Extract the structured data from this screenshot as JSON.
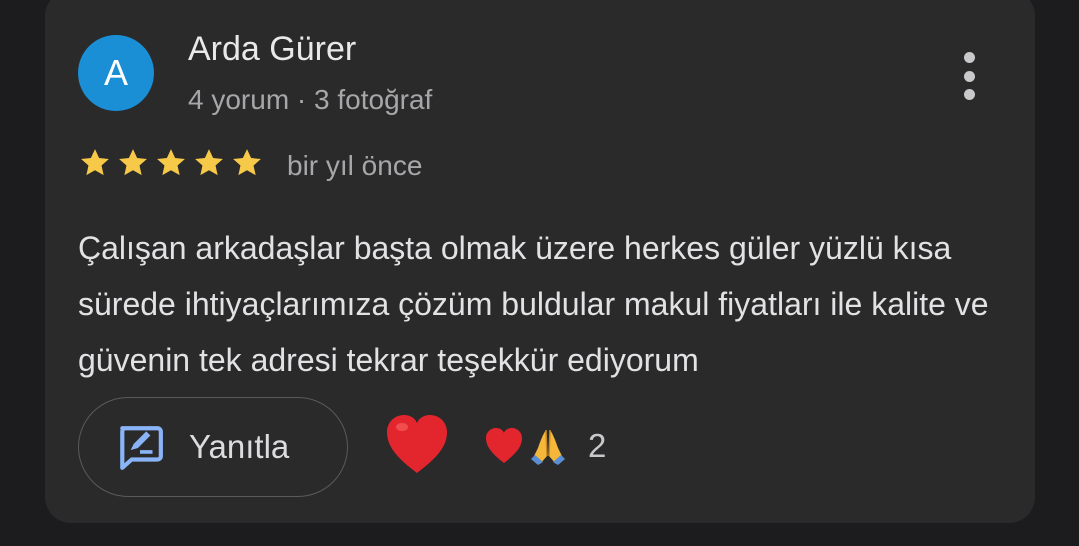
{
  "review": {
    "avatar_letter": "A",
    "author": "Arda Gürer",
    "author_meta": "4 yorum · 3 fotoğraf",
    "rating": 5,
    "rating_max": 5,
    "time": "bir yıl önce",
    "text": "Çalışan arkadaşlar başta olmak üzere herkes güler yüzlü kısa sürede ihtiyaçlarımıza çözüm buldular makul fiyatları ile kalite ve güvenin tek adresi tekrar teşekkür ediyorum",
    "reply_label": "Yanıtla",
    "reaction_count": "2",
    "icons": {
      "more": "more-vert-icon",
      "reply": "reply-message-icon",
      "react": "red-heart-icon",
      "reactions": [
        "red-heart-icon",
        "folded-hands-icon"
      ]
    }
  },
  "colors": {
    "background": "#1c1c1e",
    "card": "#2a2a2b",
    "avatar": "#1a8fd6",
    "star": "#f7c948",
    "reply_icon": "#8ab4f8",
    "heart": "#e3262e"
  }
}
